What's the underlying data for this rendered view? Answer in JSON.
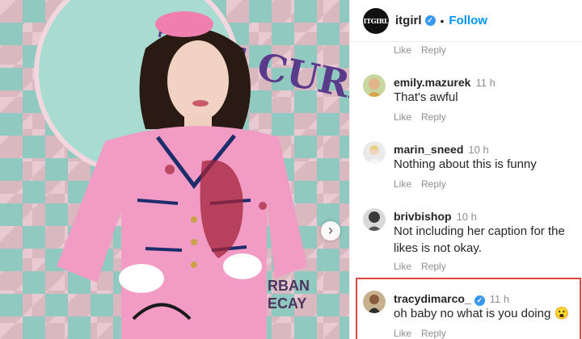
{
  "post": {
    "author": "itgirl",
    "author_logo_text": "ITGIRL",
    "follow_label": "Follow",
    "separator": "•",
    "verified_icon": "✓",
    "next_icon": "›",
    "photo_wall_text_1": "URBAN",
    "photo_wall_text_2": "DECAY",
    "photo_sign_text": "THE CURE"
  },
  "actions": {
    "like": "Like",
    "reply": "Reply"
  },
  "comments": [
    {
      "user": "emily.mazurek",
      "time": "11 h",
      "text": "That's awful"
    },
    {
      "user": "marin_sneed",
      "time": "10 h",
      "text": "Nothing about this is funny"
    },
    {
      "user": "brivbishop",
      "time": "10 h",
      "text": "Not including her caption for the likes is not okay."
    },
    {
      "user": "tracydimarco_",
      "time": "11 h",
      "text": "oh baby no what is you doing 😮",
      "verified": true,
      "highlighted": true
    }
  ],
  "colors": {
    "accent": "#0095f6",
    "highlight": "#e0473f",
    "suit": "#f29bc4"
  }
}
